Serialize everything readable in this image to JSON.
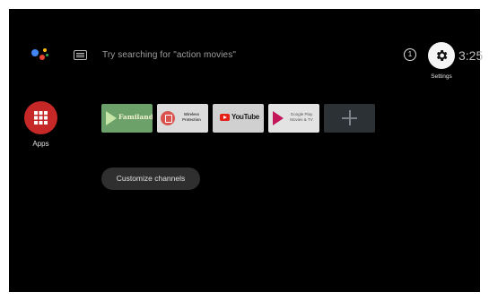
{
  "top_bar": {
    "assistant_icon": "google-assistant-icon",
    "keyboard_icon": "keyboard-icon",
    "search_hint": "Try searching for \"action movies\"",
    "notification_icon": "info-circle-icon",
    "notification_count": "1",
    "settings_icon": "gear-icon",
    "settings_label": "Settings",
    "clock": "3:25"
  },
  "apps": {
    "icon": "apps-grid-icon",
    "label": "Apps"
  },
  "favorites": [
    {
      "text": "Familand",
      "icon": "familand-play-icon"
    },
    {
      "text": "Wireless Protection",
      "icon": "wireless-protection-icon"
    },
    {
      "text": "YouTube",
      "icon": "youtube-icon"
    },
    {
      "text": "Google Play Movies & TV",
      "icon": "google-play-movies-icon"
    },
    {
      "text": "",
      "icon": "plus-icon"
    }
  ],
  "customize_label": "Customize channels",
  "colors": {
    "screen_bg": "#000000",
    "apps_red": "#c62828",
    "familand_green": "#6ca16a",
    "youtube_red": "#e62117"
  }
}
